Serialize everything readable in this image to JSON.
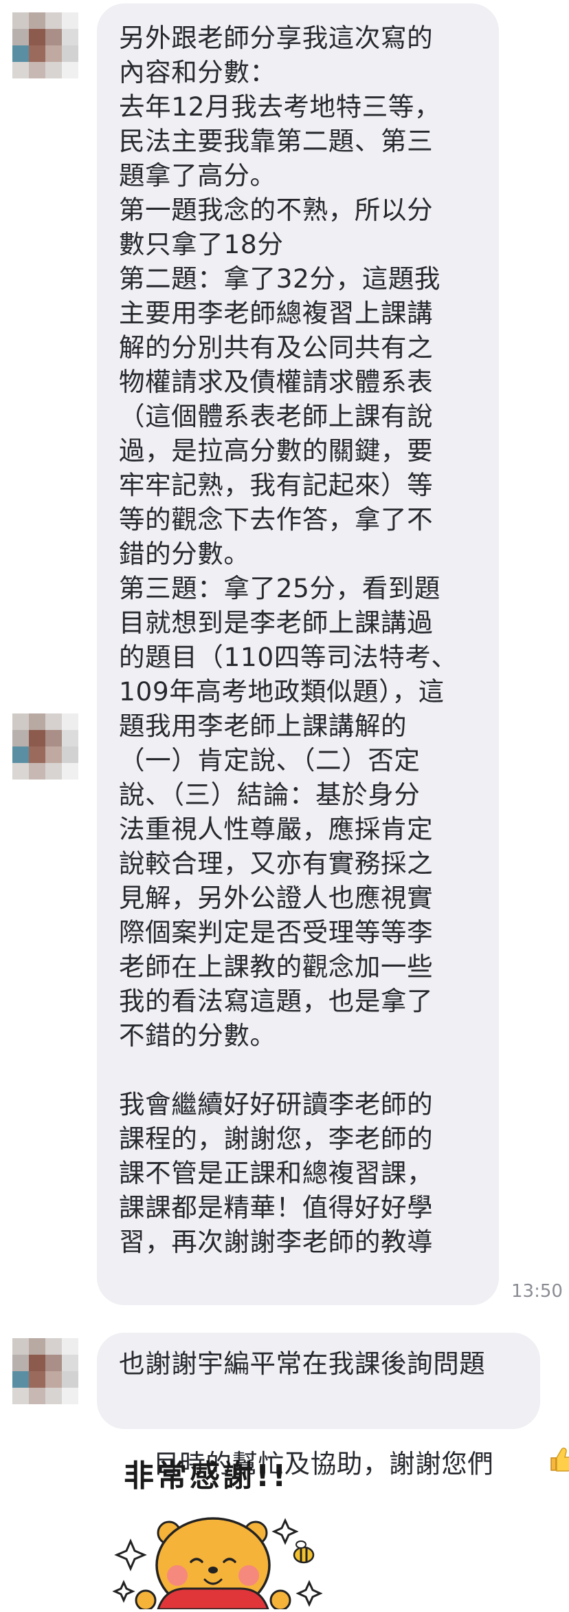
{
  "messages": [
    {
      "lines": [
        "另外跟老師分享我這次寫的",
        "內容和分數：",
        "去年12月我去考地特三等，",
        "民法主要我靠第二題、第三",
        "題拿了高分。",
        "第一題我念的不熟，所以分",
        "數只拿了18分",
        "第二題：拿了32分，這題我",
        "主要用李老師總複習上課講",
        "解的分別共有及公同共有之",
        "物權請求及債權請求體系表",
        "（這個體系表老師上課有說",
        "過，是拉高分數的關鍵，要",
        "牢牢記熟，我有記起來）等",
        "等的觀念下去作答，拿了不",
        "錯的分數。",
        "第三題：拿了25分，看到題",
        "目就想到是李老師上課講過",
        "的題目（110四等司法特考、",
        "109年高考地政類似題），這",
        "題我用李老師上課講解的",
        "（一）肯定說、（二）否定",
        "說、（三）結論：基於身分",
        "法重視人性尊嚴，應採肯定",
        "說較合理，又亦有實務採之",
        "見解，另外公證人也應視實",
        "際個案判定是否受理等等李",
        "老師在上課教的觀念加一些",
        "我的看法寫這題，也是拿了",
        "不錯的分數。",
        "",
        "我會繼續好好研讀李老師的",
        "課程的，謝謝您，李老師的",
        "課不管是正課和總複習課，",
        "課課都是精華！值得好好學",
        "習，再次謝謝李老師的教導"
      ],
      "time": "13:50"
    },
    {
      "lines": [
        "也謝謝宇編平常在我課後詢問題",
        "目時的幫忙及協助，謝謝您們"
      ],
      "emoji": "thumbs-up-icon"
    }
  ],
  "sticker": {
    "text": "非常感謝!!",
    "icon": "winnie-the-pooh-sticker"
  }
}
